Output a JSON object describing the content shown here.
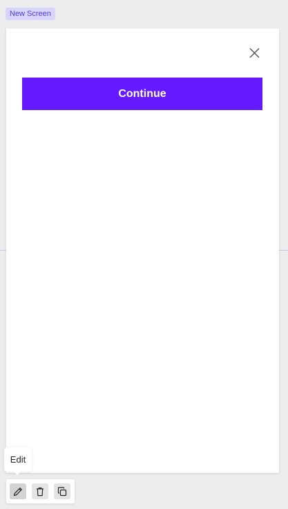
{
  "screen": {
    "label": "New Screen"
  },
  "modal": {
    "close_icon": "close-icon",
    "continue_label": "Continue",
    "accent_color": "#6419ff"
  },
  "toolbar": {
    "tooltip": "Edit",
    "tools": [
      {
        "name": "edit",
        "icon": "pencil-icon",
        "active": true
      },
      {
        "name": "delete",
        "icon": "trash-icon",
        "active": false
      },
      {
        "name": "duplicate",
        "icon": "copy-icon",
        "active": false
      }
    ]
  }
}
